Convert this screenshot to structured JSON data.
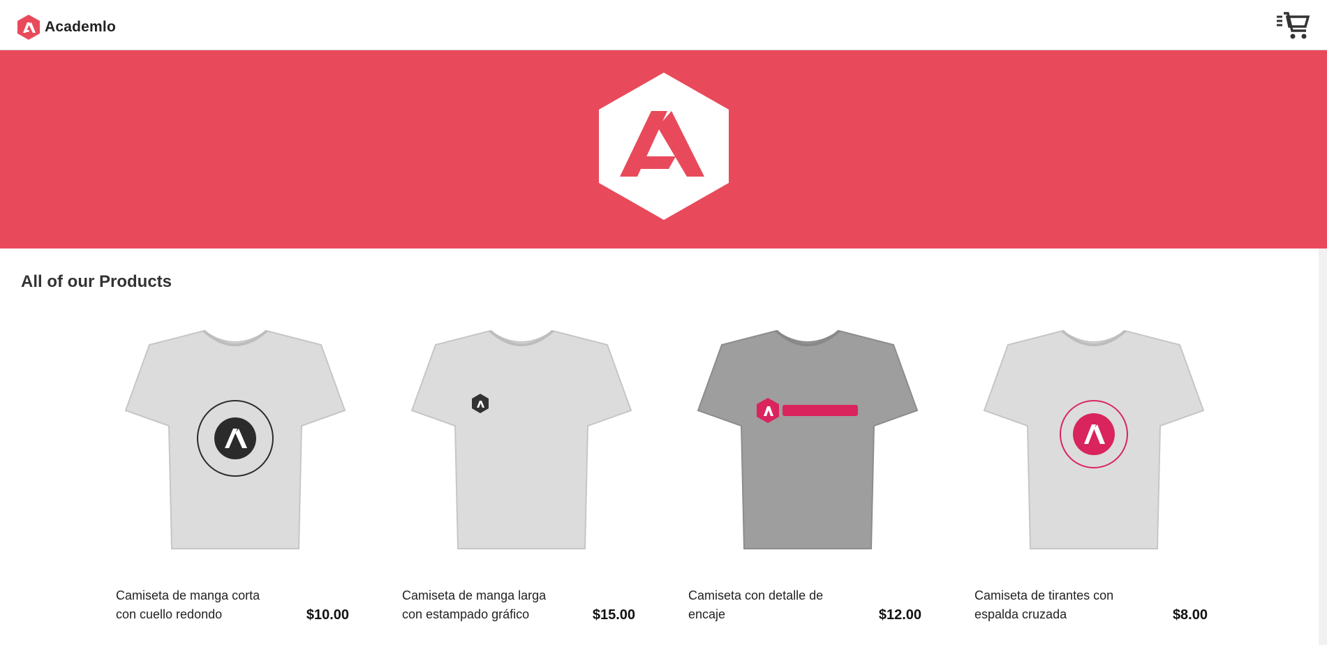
{
  "header": {
    "brand_name": "Academlo",
    "logo_icon": "academlo-hexagon-logo",
    "cart_icon": "shopping-cart-icon",
    "accent_color": "#e84a5b"
  },
  "hero": {
    "background_color": "#e84a5b",
    "logo_icon": "academlo-hexagon-logo"
  },
  "section": {
    "title": "All of our Products"
  },
  "products": [
    {
      "title": "Camiseta de manga corta con cuello redondo",
      "price": "$10.00",
      "shirt_color": "#d8d8d8",
      "print": "black-round-badge"
    },
    {
      "title": "Camiseta de manga larga con estampado gráfico",
      "price": "$15.00",
      "shirt_color": "#d8d8d8",
      "print": "small-chest-logo"
    },
    {
      "title": "Camiseta con detalle de encaje",
      "price": "$12.00",
      "shirt_color": "#9c9c9c",
      "print": "pink-wordmark"
    },
    {
      "title": "Camiseta de tirantes con espalda cruzada",
      "price": "$8.00",
      "shirt_color": "#d8d8d8",
      "print": "pink-round-badge"
    }
  ]
}
